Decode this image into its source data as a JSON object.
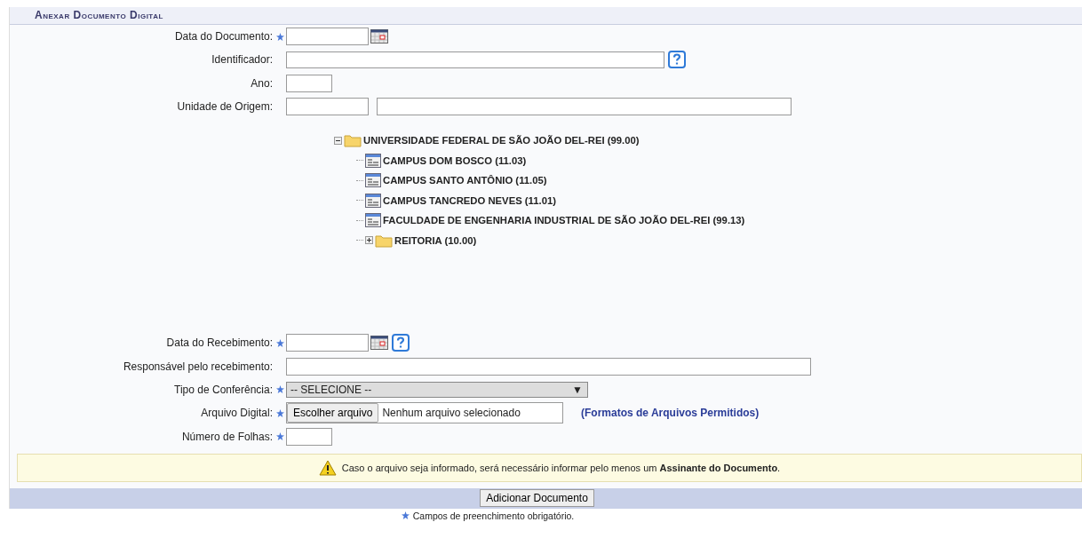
{
  "panel": {
    "title": "Anexar Documento Digital"
  },
  "fields_top": [
    {
      "label": "Data do Documento:",
      "required": true,
      "kind": "date",
      "help": false
    },
    {
      "label": "Identificador:",
      "required": false,
      "kind": "text",
      "help": true
    },
    {
      "label": "Ano:",
      "required": false,
      "kind": "short",
      "help": false
    },
    {
      "label": "Unidade de Origem:",
      "required": false,
      "kind": "pair",
      "help": false
    }
  ],
  "tree": [
    {
      "label": "UNIVERSIDADE FEDERAL DE SÃO JOÃO DEL-REI (99.00)",
      "kind": "folder",
      "expanded": true,
      "children": [
        {
          "label": "CAMPUS DOM BOSCO (11.03)",
          "kind": "unit"
        },
        {
          "label": "CAMPUS SANTO ANTÔNIO (11.05)",
          "kind": "unit"
        },
        {
          "label": "CAMPUS TANCREDO NEVES (11.01)",
          "kind": "unit"
        },
        {
          "label": "FACULDADE DE ENGENHARIA INDUSTRIAL DE SÃO JOÃO DEL-REI (99.13)",
          "kind": "unit"
        },
        {
          "label": "REITORIA (10.00)",
          "kind": "folder",
          "expanded": false
        }
      ]
    }
  ],
  "fields_bottom": [
    {
      "label": "Data do Recebimento:",
      "required": true,
      "kind": "date",
      "help": true
    },
    {
      "label": "Responsável pelo recebimento:",
      "required": false,
      "kind": "wide",
      "help": false
    },
    {
      "label": "Tipo de Conferência:",
      "required": true,
      "kind": "select",
      "help": false,
      "value": "-- SELECIONE --",
      "arrow": "▼"
    },
    {
      "label": "Arquivo Digital:",
      "required": true,
      "kind": "file",
      "help": false,
      "button": "Escolher arquivo",
      "value": "Nenhum arquivo selecionado",
      "link": "(Formatos de Arquivos Permitidos)"
    },
    {
      "label": "Número de Folhas:",
      "required": true,
      "kind": "short",
      "help": false
    }
  ],
  "warning": "Caso o arquivo seja informado, será necessário informar pelo menos um **Assinante do Documento**.",
  "submit": "Adicionar Documento",
  "footnote": "Campos de preenchimento obrigatório."
}
